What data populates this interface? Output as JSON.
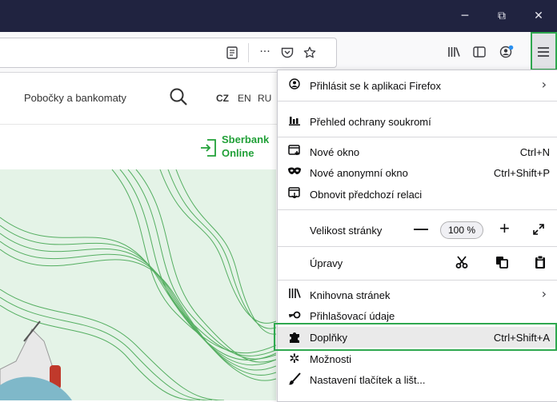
{
  "window_controls": {
    "minimize": "─",
    "restore": "⧉",
    "close": "✕"
  },
  "toolbar": {
    "reader_icon": "reader-view-icon",
    "more_label": "···",
    "pocket_icon": "pocket-icon",
    "star_icon": "bookmark-star-icon",
    "library_icon": "library-icon",
    "sidebar_icon": "sidebar-icon",
    "account_icon": "account-icon",
    "menu_icon": "hamburger-menu-icon"
  },
  "site": {
    "branches": "Pobočky a bankomaty",
    "lang_cz": "CZ",
    "lang_en": "EN",
    "lang_ru": "RU",
    "online_line1": "Sberbank",
    "online_line2": "Online",
    "accent": "#21a038"
  },
  "menu": {
    "sign_in": "Přihlásit se k aplikaci Firefox",
    "privacy": "Přehled ochrany soukromí",
    "new_window": "Nové okno",
    "new_window_sc": "Ctrl+N",
    "private_window": "Nové anonymní okno",
    "private_window_sc": "Ctrl+Shift+P",
    "restore_session": "Obnovit předchozí relaci",
    "zoom_label": "Velikost stránky",
    "zoom_minus": "—",
    "zoom_value": "100 %",
    "zoom_plus": "+",
    "edit_label": "Úpravy",
    "library": "Knihovna stránek",
    "logins": "Přihlašovací údaje",
    "addons": "Doplňky",
    "addons_sc": "Ctrl+Shift+A",
    "options": "Možnosti",
    "customize": "Nastavení tlačítek a lišt..."
  },
  "highlight_color": "#2fa84f"
}
